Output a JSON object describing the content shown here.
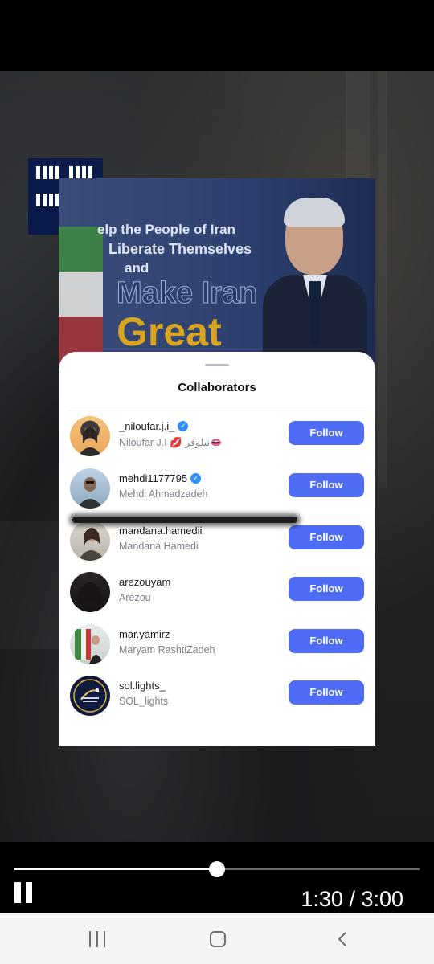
{
  "poster": {
    "line1": "elp the People of Iran",
    "line2": "Liberate Themselves",
    "line3": "and",
    "line4": "Make Iran",
    "line5": "Great"
  },
  "sheet": {
    "title": "Collaborators",
    "follow_label": "Follow",
    "collaborators": [
      {
        "username": "_niloufar.j.i_",
        "fullname": "Niloufar J.I 💋 نیلوفر👄",
        "verified": true
      },
      {
        "username": "mehdi1177795",
        "fullname": "Mehdi Ahmadzadeh",
        "verified": true
      },
      {
        "username": "mandana.hamedii",
        "fullname": "Mandana Hamedi",
        "verified": false
      },
      {
        "username": "arezouyam",
        "fullname": "Arézou",
        "verified": false
      },
      {
        "username": "mar.yamirz",
        "fullname": "Maryam RashtiZadeh",
        "verified": false
      },
      {
        "username": "sol.lights_",
        "fullname": "SOL_lights",
        "verified": false
      }
    ]
  },
  "player": {
    "time": "1:30 / 3:00",
    "progress": 0.5
  },
  "colors": {
    "accent": "#4e6cf5",
    "verified": "#2e90ff"
  }
}
